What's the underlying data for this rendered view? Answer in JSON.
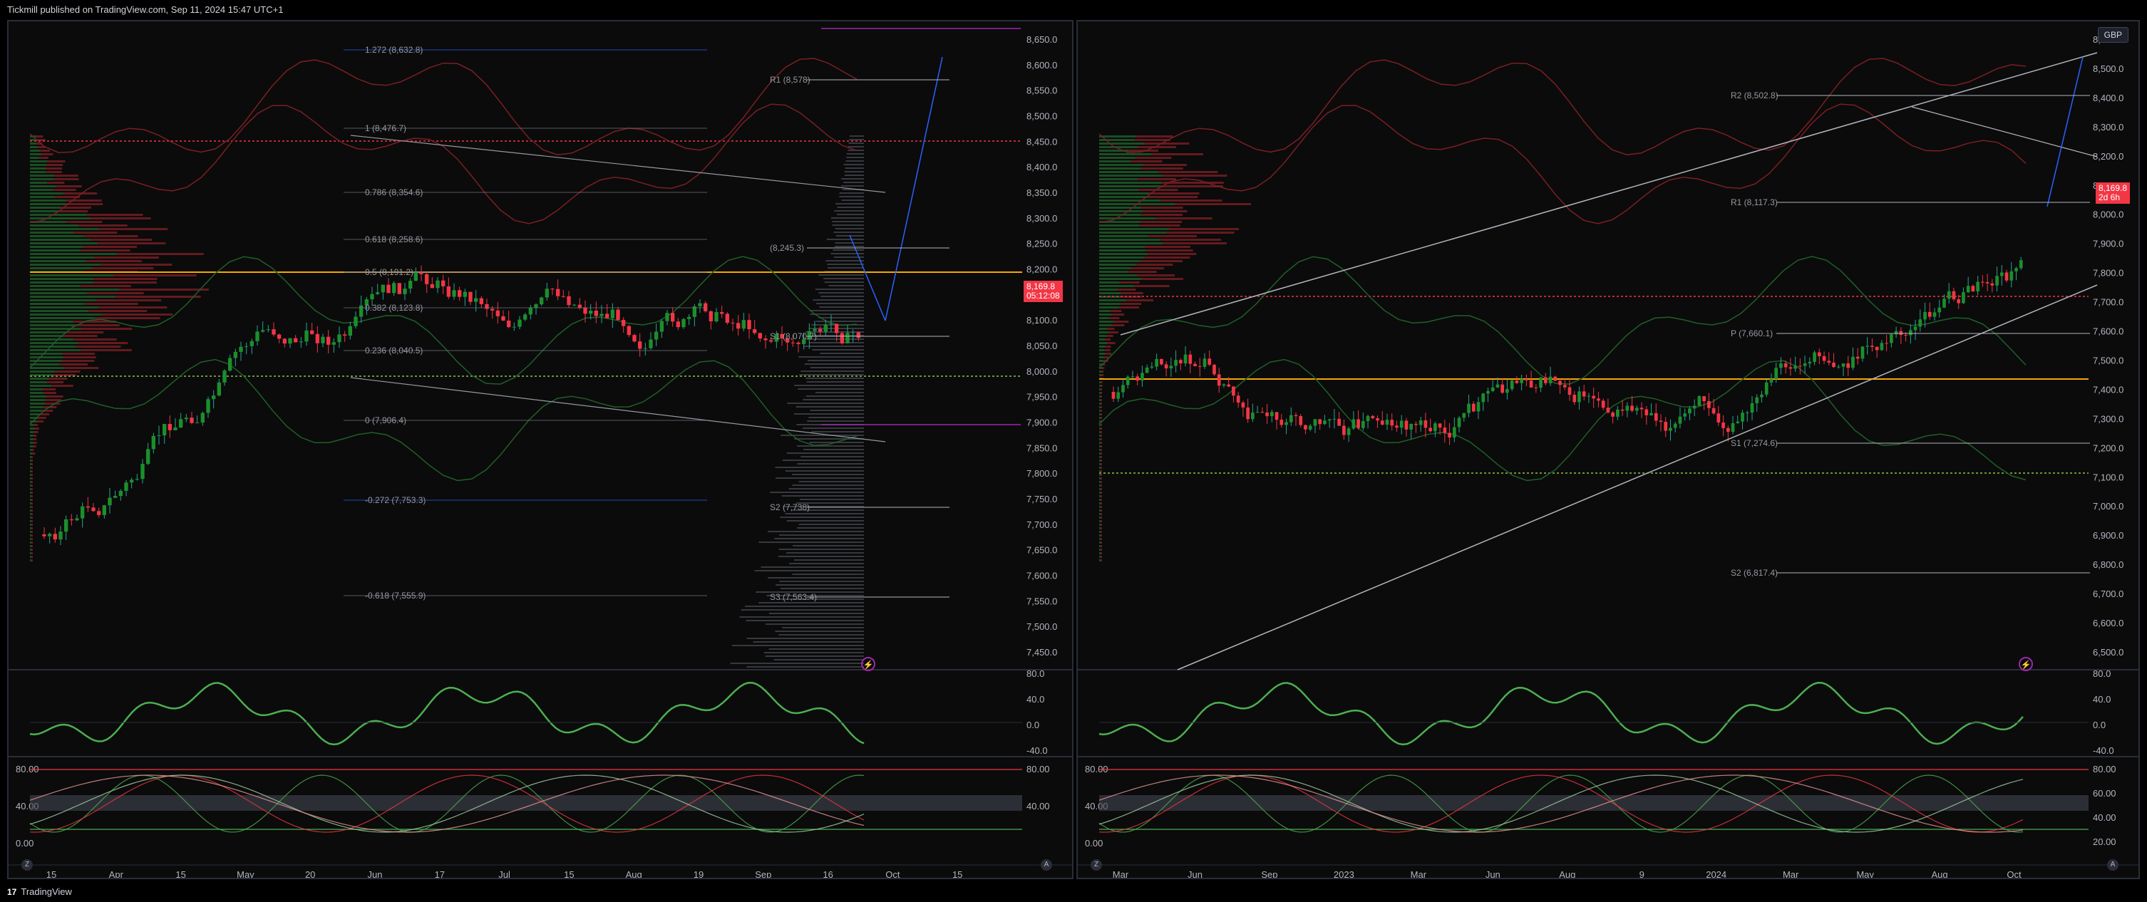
{
  "header": {
    "published": "Tickmill published on TradingView.com, Sep 11, 2024 15:47 UTC+1"
  },
  "footer": {
    "brand": "TradingView",
    "logo": "17"
  },
  "colors": {
    "bull": "#22ab94",
    "bull_body": "#1b8f2a",
    "bear": "#f23645",
    "bg": "#0b0b0b",
    "grid": "#1e222d",
    "fib": "#2962ff",
    "pivot": "#9598a1",
    "poc": "#f7a600"
  },
  "left": {
    "currency": "",
    "price_axis": [
      "8,650.0",
      "8,600.0",
      "8,550.0",
      "8,500.0",
      "8,450.0",
      "8,400.0",
      "8,350.0",
      "8,300.0",
      "8,250.0",
      "8,200.0",
      "8,150.0",
      "8,100.0",
      "8,050.0",
      "8,000.0",
      "7,950.0",
      "7,900.0",
      "7,850.0",
      "7,800.0",
      "7,750.0",
      "7,700.0",
      "7,650.0",
      "7,600.0",
      "7,550.0",
      "7,500.0",
      "7,450.0"
    ],
    "time_axis": [
      "15",
      "Apr",
      "15",
      "May",
      "20",
      "Jun",
      "17",
      "Jul",
      "15",
      "Aug",
      "19",
      "Sep",
      "16",
      "Oct",
      "15"
    ],
    "last_price": "8,169.8",
    "countdown": "05:12:08",
    "fib_labels": [
      "1.272 (8,632.8)",
      "1 (8,476.7)",
      "0.786 (8,354.6)",
      "0.618 (8,258.6)",
      "0.5 (8,191.2)",
      "0.382 (8,123.8)",
      "0.236 (8,040.5)",
      "0 (7,906.4)",
      "-0.272 (7,753.3)",
      "-0.618 (7,555.9)"
    ],
    "pivot_labels": [
      "R1 (8,578)",
      "(8,245.3)",
      "S1 (8,070.7)",
      "S2 (7,738)",
      "S3 (7,563.4)"
    ],
    "osc1_axis": [
      "80.0",
      "40.0",
      "0.0",
      "-40.0"
    ],
    "osc2_axis": [
      "80.00",
      "40.00",
      "0.00"
    ],
    "osc2_right": [
      "80.00",
      "40.00"
    ],
    "z_btn": "Z",
    "a_btn": "A"
  },
  "right": {
    "currency": "GBP",
    "price_axis": [
      "8,600.0",
      "8,500.0",
      "8,400.0",
      "8,300.0",
      "8,200.0",
      "8,100.0",
      "8,000.0",
      "7,900.0",
      "7,800.0",
      "7,700.0",
      "7,600.0",
      "7,500.0",
      "7,400.0",
      "7,300.0",
      "7,200.0",
      "7,100.0",
      "7,000.0",
      "6,900.0",
      "6,800.0",
      "6,700.0",
      "6,600.0",
      "6,500.0"
    ],
    "time_axis": [
      "Mar",
      "Jun",
      "Sep",
      "2023",
      "Mar",
      "Jun",
      "Aug",
      "9",
      "2024",
      "Mar",
      "May",
      "Aug",
      "Oct"
    ],
    "last_price": "8,169.8",
    "countdown": "2d 6h",
    "pivot_labels": [
      "R2 (8,502.8)",
      "R1 (8,117.3)",
      "P (7,660.1)",
      "S1 (7,274.6)",
      "S2 (6,817.4)"
    ],
    "osc1_axis": [
      "80.0",
      "40.0",
      "0.0",
      "-40.0"
    ],
    "osc2_axis": [
      "80.00",
      "40.00",
      "0.00"
    ],
    "osc2_right": [
      "80.00",
      "60.00",
      "40.00",
      "20.00"
    ],
    "z_btn": "Z",
    "a_btn": "A"
  }
}
